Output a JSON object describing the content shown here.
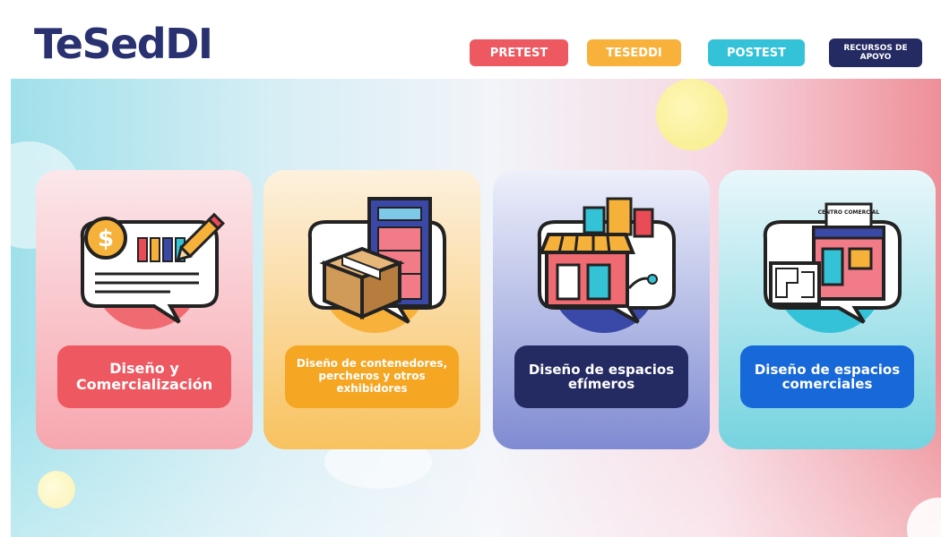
{
  "header": {
    "logo": "TeSedDI",
    "nav": [
      {
        "label": "PRETEST",
        "color": "#ee5861"
      },
      {
        "label": "TESEDDI",
        "color": "#f8b23c"
      },
      {
        "label": "POSTEST",
        "color": "#34c2d8"
      },
      {
        "label": "RECURSOS DE APOYO",
        "color": "#242a62"
      }
    ]
  },
  "cards": [
    {
      "label": "Diseño y Comercialización",
      "icon": "money-document-pencil-icon",
      "color": "#ee5861"
    },
    {
      "label": "Diseño de contenedores, percheros y otros exhibidores",
      "icon": "box-display-shelf-icon",
      "color": "#f5a623"
    },
    {
      "label": "Diseño de espacios efímeros",
      "icon": "storefront-kiosk-icon",
      "color": "#242a62"
    },
    {
      "label": "Diseño de espacios comerciales",
      "icon": "shopping-center-blueprint-icon",
      "color": "#1768d8"
    }
  ],
  "illustration_text": {
    "centro_comercial": "CENTRO COMERCIAL"
  }
}
